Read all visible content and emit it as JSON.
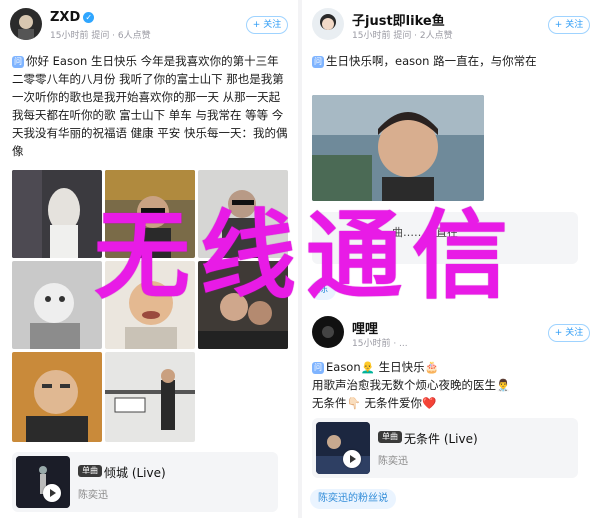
{
  "left_post": {
    "username": "ZXD",
    "meta": "15小时前 提问 · 6人点赞",
    "follow_label": "+ 关注",
    "text": "你好 Eason 生日快乐 今年是我喜欢你的第十三年 二零零八年的八月份 我听了你的富士山下 那也是我第一次听你的歌也是我开始喜欢你的那一天 从那一天起 我每天都在听你的歌 富士山下 单车 与我常在 等等 今天我没有华丽的祝福语 健康 平安 快乐每一天：我的偶像",
    "music": {
      "badge": "单曲",
      "title": "倾城 (Live)",
      "artist": "陈奕迅"
    }
  },
  "right_post": {
    "username": "子just即like鱼",
    "meta": "15小时前 提问 · 2人点赞",
    "follow_label": "+ 关注",
    "text": "生日快乐啊，eason 路一直在，与你常在",
    "quote_partial": "曲……一直在",
    "chip_partial": "陈"
  },
  "third_post": {
    "username": "哩哩",
    "meta": "15小时前 · ...",
    "follow_label": "+ 关注",
    "text_line1": "Eason👨‍🦲 生日快乐🎂",
    "text_line2": "用歌声治愈我无数个烦心夜晚的医生👨‍⚕️",
    "text_line3": "无条件👇🏻 无条件爱你❤️",
    "music": {
      "badge": "单曲",
      "title": "无条件 (Live)",
      "artist": "陈奕迅"
    },
    "fan_chip": "陈奕迅的粉丝说"
  },
  "overlay_text": "无线通信",
  "colors": {
    "accent_blue": "#2f9cf5",
    "overlay_magenta": "#e81be6"
  }
}
